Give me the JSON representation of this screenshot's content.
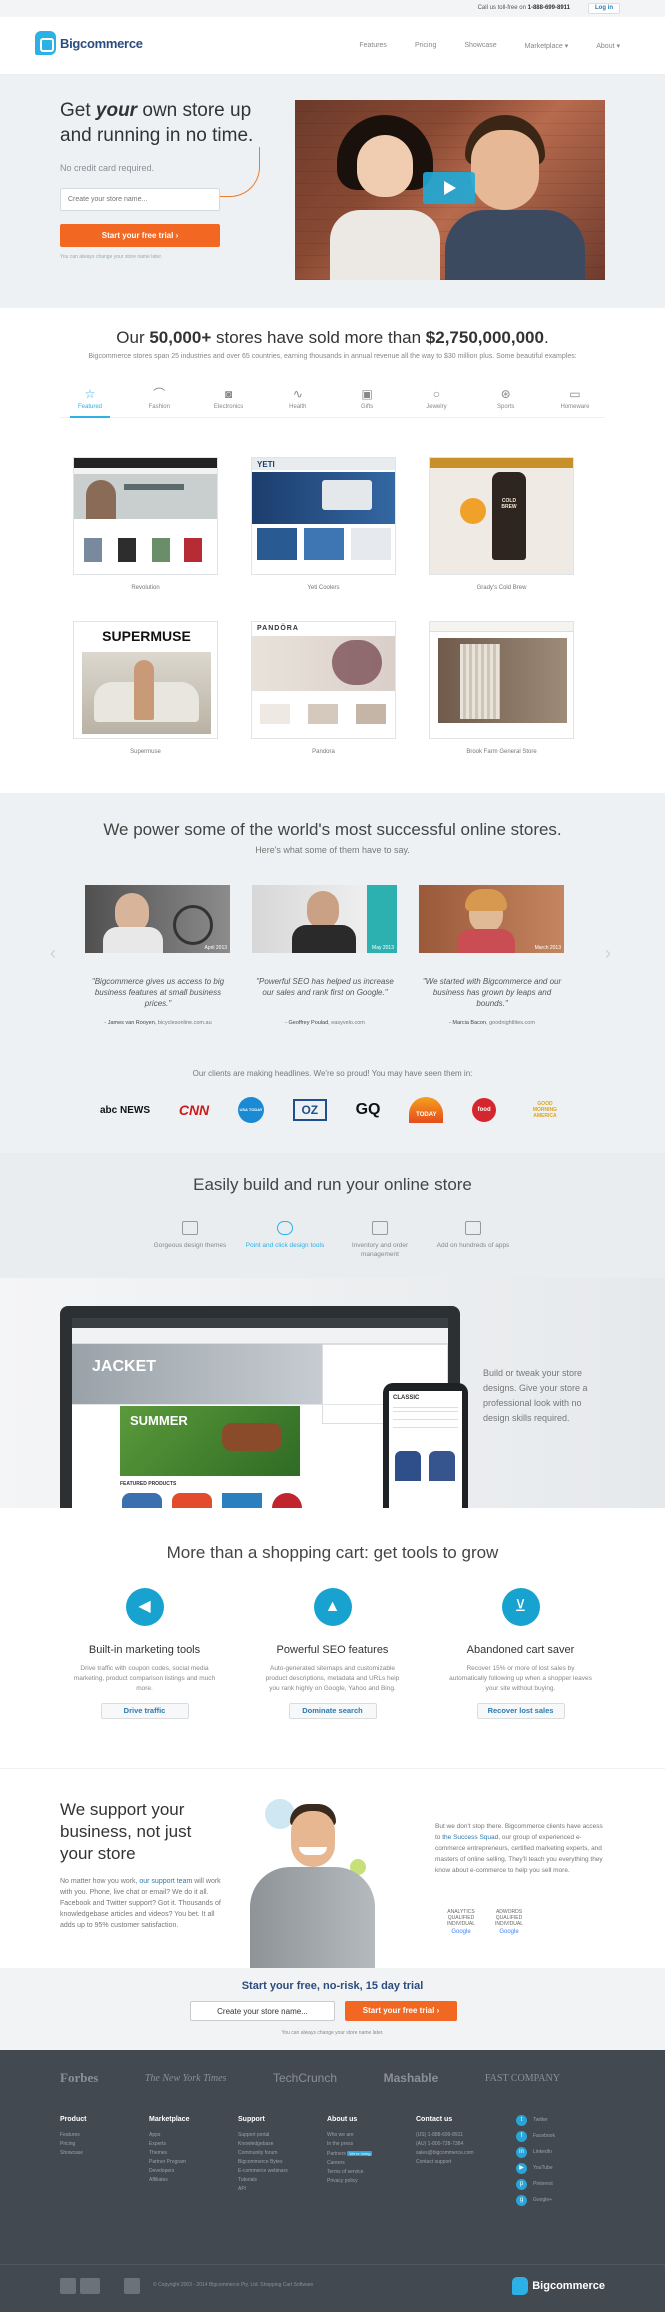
{
  "topbar": {
    "tollfree_prefix": "Call us toll-free on ",
    "tollfree_number": "1-888-699-8911",
    "login": "Log in"
  },
  "header": {
    "brand": "Bigcommerce",
    "nav": [
      "Features",
      "Pricing",
      "Showcase",
      "Marketplace ▾",
      "About ▾"
    ]
  },
  "hero": {
    "headline_pre": "Get ",
    "headline_em": "your",
    "headline_post": " own store up and running in no time.",
    "no_cc": "No credit card required.",
    "input_placeholder": "Create your store name...",
    "cta": "Start your free trial  ›",
    "change_note": "You can always change your store name later."
  },
  "stores": {
    "title_pre": "Our ",
    "title_bold1": "50,000+",
    "title_mid": " stores have sold more than ",
    "title_bold2": "$2,750,000,000",
    "title_post": ".",
    "subtitle": "Bigcommerce stores span 25 industries and over 65 countries, earning thousands in annual revenue all the way to $30 million plus. Some beautiful examples:",
    "categories": [
      {
        "label": "Featured",
        "icon": "star-icon"
      },
      {
        "label": "Fashion",
        "icon": "hanger-icon"
      },
      {
        "label": "Electronics",
        "icon": "camera-icon"
      },
      {
        "label": "Health",
        "icon": "pulse-icon"
      },
      {
        "label": "Gifts",
        "icon": "gift-icon"
      },
      {
        "label": "Jewelry",
        "icon": "ring-icon"
      },
      {
        "label": "Sports",
        "icon": "ball-icon"
      },
      {
        "label": "Homeware",
        "icon": "sofa-icon"
      }
    ],
    "showcase": [
      {
        "name": "Revolution"
      },
      {
        "name": "Yeti Coolers"
      },
      {
        "name": "Grady's Cold Brew"
      },
      {
        "name": "Supermuse"
      },
      {
        "name": "Pandora"
      },
      {
        "name": "Brook Farm General Store"
      }
    ],
    "thumb_text": {
      "yeti": "YETI",
      "supermuse": "SUPERMUSE",
      "pandora": "PANDÖRA",
      "grady1": "COLD",
      "grady2": "BREW"
    }
  },
  "testimonials": {
    "title": "We power some of the world's most successful online stores.",
    "subtitle": "Here's what some of them have to say.",
    "items": [
      {
        "quote": "\"Bigcommerce gives us access to big business features at small business prices.\"",
        "name": "- James van Rooyen",
        "site": ", bicyclesonline.com.au",
        "tag": "April 2013"
      },
      {
        "quote": "\"Powerful SEO has helped us increase our sales and rank first on Google.\"",
        "name": "- Geoffrey Poulad",
        "site": ", easyvelo.com",
        "tag": "May 2013"
      },
      {
        "quote": "\"We started with Bigcommerce and our business has grown by leaps and bounds.\"",
        "name": "- Marcia Bacon",
        "site": ", goodnightlites.com",
        "tag": "March 2013"
      }
    ],
    "press_line": "Our clients are making headlines. We're so proud! You may have seen them in:",
    "press_logos": [
      "abc NEWS",
      "CNN",
      "USA TODAY",
      "OZ",
      "GQ",
      "TODAY",
      "food",
      "GOOD MORNING AMERICA"
    ]
  },
  "build": {
    "title": "Easily build and run your online store",
    "features": [
      {
        "label": "Gorgeous design themes",
        "icon": "image-icon"
      },
      {
        "label": "Point and click design tools",
        "icon": "hand-icon"
      },
      {
        "label": "Inventory and order management",
        "icon": "box-icon"
      },
      {
        "label": "Add on hundreds of apps",
        "icon": "tools-icon"
      }
    ],
    "description": "Build or tweak your store designs. Give your store a professional look with no design skills required.",
    "screen_text": {
      "jacket": "JACKET",
      "summer": "SUMMER",
      "featured": "FEATURED PRODUCTS",
      "classic": "CLASSIC"
    }
  },
  "tools": {
    "title": "More than a shopping cart: get tools to grow",
    "items": [
      {
        "title": "Built-in marketing tools",
        "desc": "Drive traffic with coupon codes, social media marketing, product comparison listings and much more.",
        "button": "Drive traffic",
        "icon": "megaphone-icon"
      },
      {
        "title": "Powerful SEO features",
        "desc": "Auto-generated sitemaps and customizable product descriptions, metadata and URLs help you rank highly on Google, Yahoo and Bing.",
        "button": "Dominate search",
        "icon": "chart-icon"
      },
      {
        "title": "Abandoned cart saver",
        "desc": "Recover 15% or more of lost sales by automatically following up when a shopper leaves your site without buying.",
        "button": "Recover lost sales",
        "icon": "cart-icon"
      }
    ]
  },
  "support": {
    "title": "We support your business, not just your store",
    "left_pre": "No matter how you work, ",
    "left_link": "our support team",
    "left_post": " will work with you. Phone, live chat or email? We do it all. Facebook and Twitter support? Got it. Thousands of knowledgebase articles and videos? You bet. It all adds up to 95% customer satisfaction.",
    "right_pre": "But we don't stop there. Bigcommerce clients have access to ",
    "right_link": "the Success Squad",
    "right_post": ", our group of experienced e-commerce entrepreneurs, certified marketing experts, and masters of online selling. They'll teach you everything they know about e-commerce to help you sell more.",
    "badges": [
      {
        "line1": "ANALYTICS",
        "line2": "QUALIFIED",
        "line3": "INDIVIDUAL",
        "brand": "Google"
      },
      {
        "line1": "ADWORDS",
        "line2": "QUALIFIED",
        "line3": "INDIVIDUAL",
        "brand": "Google"
      }
    ]
  },
  "trial": {
    "title": "Start your free, no-risk, 15 day trial",
    "input_value": "Create your store name...",
    "cta": "Start your free trial  ›",
    "note": "You can always change your store name later."
  },
  "footer": {
    "press": [
      "Forbes",
      "The New York Times",
      "TechCrunch",
      "Mashable",
      "FAST COMPANY"
    ],
    "columns": [
      {
        "title": "Product",
        "links": [
          "Features",
          "Pricing",
          "Showcase"
        ]
      },
      {
        "title": "Marketplace",
        "links": [
          "Apps",
          "Experts",
          "Themes",
          "Partner Program",
          "Developers",
          "Affiliates"
        ]
      },
      {
        "title": "Support",
        "links": [
          "Support portal",
          "Knowledgebase",
          "Community forum",
          "Bigcommerce Bytes",
          "E-commerce webinars",
          "Tutorials",
          "API"
        ]
      },
      {
        "title": "About us",
        "links": [
          "Who we are",
          "In the press",
          "Partners",
          "Careers",
          "Terms of service",
          "Privacy policy"
        ]
      },
      {
        "title": "Contact us",
        "links": [
          "(US) 1-888-699-8911",
          "(AU) 1-800-728-7384",
          "sales@bigcommerce.com",
          "Contact support"
        ]
      }
    ],
    "hiring_badge": "We're hiring",
    "social": [
      "Twitter",
      "Facebook",
      "LinkedIn",
      "YouTube",
      "Pinterest",
      "Google+"
    ],
    "copyright": "© Copyright 2003 - 2014 Bigcommerce Pty. Ltd. Shopping Cart Software",
    "brand": "Bigcommerce"
  },
  "colors": {
    "accent": "#2bb1e6",
    "cta": "#f26722",
    "brand_text": "#2b4c7e",
    "footer_bg": "#434950"
  }
}
